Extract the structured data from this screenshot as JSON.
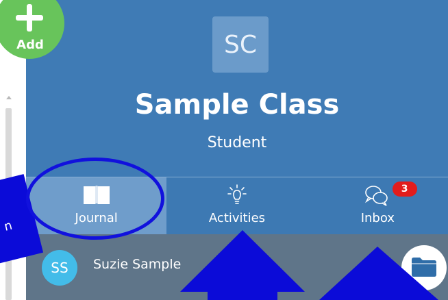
{
  "add_button": {
    "label": "Add",
    "icon": "plus-icon"
  },
  "header": {
    "avatar_initials": "SC",
    "title": "Sample Class",
    "subtitle": "Student"
  },
  "tabs": [
    {
      "label": "Journal",
      "icon": "book-icon",
      "active": true
    },
    {
      "label": "Activities",
      "icon": "lightbulb-icon",
      "active": false
    },
    {
      "label": "Inbox",
      "icon": "chat-bubbles-icon",
      "active": false,
      "badge": "3"
    }
  ],
  "student": {
    "initials": "SS",
    "name": "Suzie Sample",
    "action_icon": "folder-icon"
  },
  "annotation": {
    "callout_text": "n"
  },
  "colors": {
    "header_bg": "#3f7bb5",
    "active_tab": "#6f9dcb",
    "student_row": "#5f7589",
    "add_button": "#68c45b",
    "badge": "#e21c1c",
    "annotation": "#1111dd"
  }
}
